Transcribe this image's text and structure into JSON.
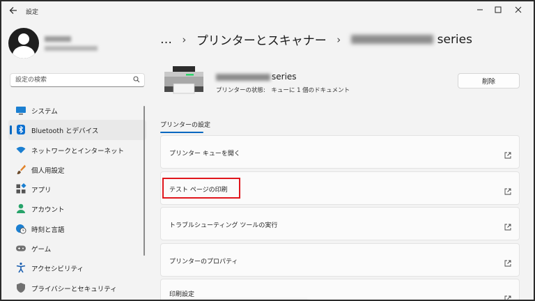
{
  "window": {
    "app_title": "設定",
    "back_icon": "back-arrow-icon",
    "controls": [
      "minimize-icon",
      "maximize-icon",
      "close-icon"
    ]
  },
  "search": {
    "placeholder": "設定の検索"
  },
  "sidebar": {
    "items": [
      {
        "label": "システム",
        "icon": "system-display-icon"
      },
      {
        "label": "Bluetooth とデバイス",
        "icon": "bluetooth-icon",
        "active": true
      },
      {
        "label": "ネットワークとインターネット",
        "icon": "wifi-icon"
      },
      {
        "label": "個人用設定",
        "icon": "brush-icon"
      },
      {
        "label": "アプリ",
        "icon": "apps-icon"
      },
      {
        "label": "アカウント",
        "icon": "account-icon"
      },
      {
        "label": "時刻と言語",
        "icon": "globe-clock-icon"
      },
      {
        "label": "ゲーム",
        "icon": "gamepad-icon"
      },
      {
        "label": "アクセシビリティ",
        "icon": "accessibility-icon"
      },
      {
        "label": "プライバシーとセキュリティ",
        "icon": "shield-icon"
      }
    ]
  },
  "breadcrumb": {
    "root": "…",
    "level1": "プリンターとスキャナー",
    "level2_suffix": "series"
  },
  "printer": {
    "name_suffix": "series",
    "status": "プリンターの状態:　キューに 1 個のドキュメント",
    "delete_label": "削除"
  },
  "tab": {
    "label": "プリンターの設定"
  },
  "cards": [
    {
      "label": "プリンター キューを開く"
    },
    {
      "label": "テスト ページの印刷",
      "highlighted": true
    },
    {
      "label": "トラブルシューティング ツールの実行"
    },
    {
      "label": "プリンターのプロパティ"
    },
    {
      "label": "印刷設定"
    }
  ],
  "colors": {
    "accent": "#0067c0",
    "highlight": "#e0161c",
    "background": "#f3f3f3"
  }
}
